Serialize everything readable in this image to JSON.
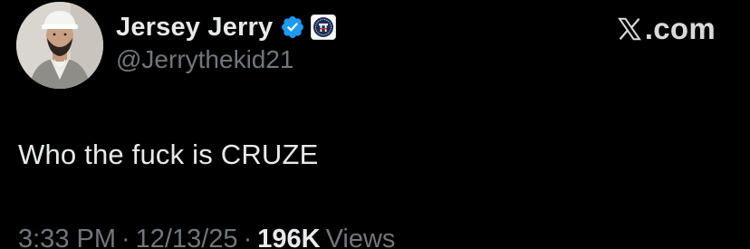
{
  "author": {
    "display_name": "Jersey Jerry",
    "handle": "@Jerrythekid21",
    "avatar": "profile-photo-icon",
    "verified_badge": "verified-checkmark-icon",
    "affiliate_badge": "barstool-affiliate-badge-icon"
  },
  "watermark": {
    "text": ".com",
    "logo": "x-logo-icon"
  },
  "tweet": {
    "text": "Who the fuck is CRUZE"
  },
  "meta": {
    "time": "3:33 PM",
    "separator": "·",
    "date": "12/13/25",
    "views_count": "196K",
    "views_label": "Views"
  },
  "colors": {
    "background": "#000000",
    "primary_text": "#e7e9ea",
    "secondary_text": "#71767b",
    "verified_blue": "#1d9bf0",
    "affiliate_navy": "#1b2d55",
    "affiliate_red": "#d12d35"
  }
}
